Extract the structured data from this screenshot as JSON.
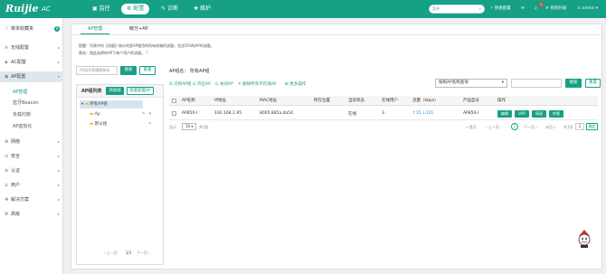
{
  "app": {
    "logo": "Ruijie",
    "logo_sub": "AC"
  },
  "topnav": [
    {
      "label": "监控",
      "icon": "monitor-icon"
    },
    {
      "label": "配置",
      "icon": "config-icon"
    },
    {
      "label": "诊断",
      "icon": "diagnose-icon"
    },
    {
      "label": "维护",
      "icon": "maintain-icon"
    }
  ],
  "top": {
    "search_placeholder": "菜单",
    "quick_config": "快速配置",
    "badge": "1",
    "system_upgrade": "系统升级",
    "user": "admin"
  },
  "sidebar": {
    "fav": "菜单收藏夹",
    "fav_badge": "0",
    "items": [
      {
        "label": "无线配置"
      },
      {
        "label": "AC配置"
      },
      {
        "label": "AP配置"
      },
      {
        "label": "网络"
      },
      {
        "label": "安全"
      },
      {
        "label": "认证"
      },
      {
        "label": "用户"
      },
      {
        "label": "解决方案"
      },
      {
        "label": "高级"
      }
    ],
    "subitems": [
      "AP管理",
      "蓝牙Beacon",
      "负载均衡",
      "AP虚拟化"
    ]
  },
  "tabs": [
    "AP管理",
    "敏分+AP"
  ],
  "desc": {
    "line1": "提醒：列表中的【流量】统计的是AP使用的所有终端的流量，包含STA的AP的流量。",
    "line2": "筛选：指此选择的AP下每个用户的流量。"
  },
  "filter": {
    "placeholder": "AP组名称模糊查询",
    "search": "搜索",
    "reset": "重置"
  },
  "group_panel": {
    "title": "AP组列表",
    "add": "添加组",
    "batch": "批量配置AP",
    "root": "所有AP组",
    "children": [
      "Ap",
      "默认组"
    ],
    "prev": "上一页",
    "page": "1/1",
    "next": "下一页"
  },
  "right": {
    "group_label": "AP组名：",
    "group_value": "所有AP组",
    "tools": [
      "迁移AP组",
      "开启AP",
      "关闭AP",
      "删除所有不在线AP",
      "更多操作"
    ],
    "query_select": "按照AP名称查询",
    "search": "搜索",
    "reset": "重置"
  },
  "table": {
    "headers": [
      "AP名称",
      "IP地址",
      "MAC地址",
      "所在位置",
      "当前状态",
      "在线用户",
      "流量（kbps）",
      "产品型号",
      "操作"
    ],
    "rows": [
      {
        "name": "AP850-I",
        "ip": "192.168.1.95",
        "mac": "8005.885a.da54",
        "loc": "",
        "status": "在线",
        "users": "3",
        "flow_up": "↑15",
        "flow_down": "↓121",
        "model": "AP850-I",
        "ops": [
          "编辑",
          "VAP",
          "网速",
          "射频"
        ]
      }
    ]
  },
  "pagination": {
    "show": "显示",
    "size": "10",
    "total": "共1条",
    "first": "首页",
    "prev": "上一页",
    "page": "1",
    "next": "下一页",
    "last": "末页",
    "total_pages": "共1页",
    "input": "1",
    "go": "确定"
  },
  "colors": {
    "accent": "#16a085",
    "link": "#2e7dd1"
  }
}
